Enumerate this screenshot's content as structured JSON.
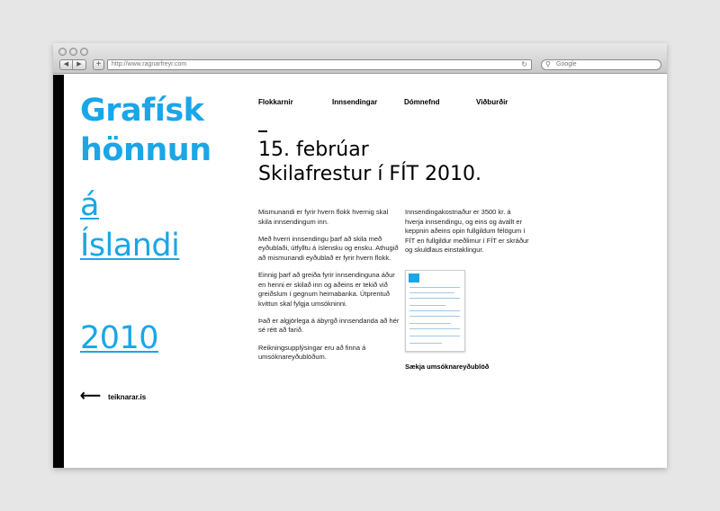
{
  "browser": {
    "url": "http://www.ragnarfreyr.com",
    "search_placeholder": "Google",
    "back_glyph": "◀",
    "forward_glyph": "▶",
    "add_glyph": "+",
    "reload_glyph": "↻",
    "search_glyph": "⚲"
  },
  "sidebar": {
    "title_line1": "Grafísk",
    "title_line2": "hönnun",
    "title_line3": "á",
    "title_line4": "Íslandi",
    "year": "2010",
    "back_arrow": "⟵",
    "back_link": "teiknarar.is",
    "accent_color": "#1aa6e8"
  },
  "nav": {
    "items": [
      {
        "label": "Flokkarnir"
      },
      {
        "label": "Innsendingar"
      },
      {
        "label": "Dómnefnd"
      },
      {
        "label": "Viðburðir"
      }
    ]
  },
  "main": {
    "heading_line1": "15. febrúar",
    "heading_line2": "Skilafrestur í FÍT 2010.",
    "col1": [
      "Mismunandi er fyrir hvern flokk hvernig skal skila innsendingum inn.",
      "Með hverri innsendingu þarf að skila með eyðublaði, útfylltu á íslensku og ensku. Athugið að mismunandi eyðublað er fyrir hvern flokk.",
      "Einnig þarf að greiða fyrir innsendinguna áður en henni er skilað inn og aðeins er tekið við greiðslum í gegnum heimabanka. Útprentuð kvittun skal fylgja umsókninni.",
      "Það er algjörlega á ábyrgð innsendanda að hér sé rétt að farið.",
      "Reikningsupplýsingar eru að finna á umsóknareyðublöðum."
    ],
    "col2": "Innsendingakostnaður er 3500 kr. á hverja innsendingu, og eins og ávallt er keppnin aðeins opin fullgildum félögum í FÍT en fullgildur meðlimur í FÍT er skráður og skuldlaus einstaklingur.",
    "download_label": "Sækja umsóknareyðublöð"
  }
}
